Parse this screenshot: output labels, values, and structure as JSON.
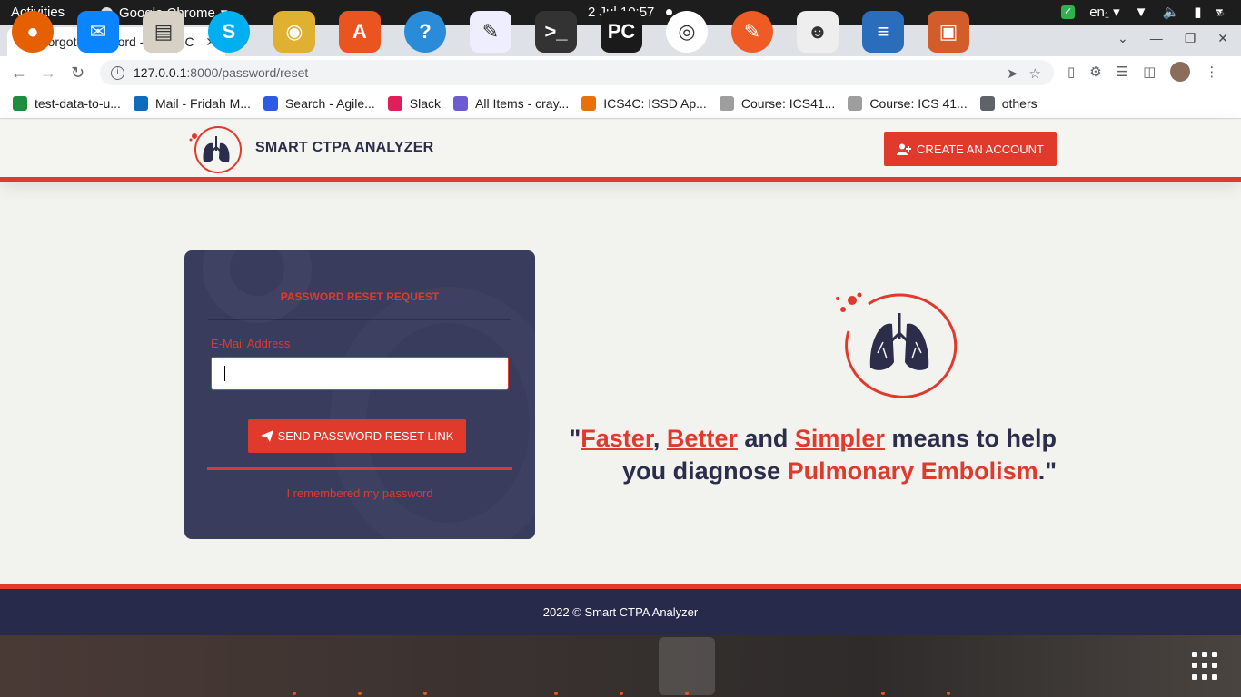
{
  "system_bar": {
    "activities": "Activities",
    "app_name": "Google Chrome",
    "clock": "2 Jul  10:57",
    "input_lang": "en₁"
  },
  "browser": {
    "tab_title": "Forgot Password - Smart C",
    "url_host": "127.0.0.1",
    "url_path": ":8000/password/reset",
    "bookmarks": [
      {
        "label": "test-data-to-u...",
        "color": "#1e8e3e"
      },
      {
        "label": "Mail - Fridah M...",
        "color": "#0f6cbd"
      },
      {
        "label": "Search - Agile...",
        "color": "#2d5be3"
      },
      {
        "label": "Slack",
        "color": "#e01e5a"
      },
      {
        "label": "All Items - cray...",
        "color": "#6d5bd0"
      },
      {
        "label": "ICS4C: ISSD Ap...",
        "color": "#e8710a"
      },
      {
        "label": "Course: ICS41...",
        "color": "#9e9e9e"
      },
      {
        "label": "Course: ICS 41...",
        "color": "#9e9e9e"
      },
      {
        "label": "others",
        "color": "#5f6368"
      }
    ]
  },
  "site": {
    "brand": "SMART CTPA ANALYZER",
    "create_account": "CREATE AN ACCOUNT",
    "accent_color": "#e03a2d",
    "navy_color": "#2b2d4a"
  },
  "reset_card": {
    "title": "PASSWORD RESET REQUEST",
    "email_label": "E-Mail Address",
    "email_value": "",
    "send_button": "SEND PASSWORD RESET LINK",
    "remember_link": "I remembered my password"
  },
  "hero": {
    "q_open": "\"",
    "word1": "Faster",
    "sep1": ", ",
    "word2": "Better",
    "and": " and ",
    "word3": "Simpler",
    "middle": " means to help you diagnose ",
    "disease": "Pulmonary Embolism",
    "q_close": ".\""
  },
  "footer": {
    "text": "2022 © Smart CTPA Analyzer"
  },
  "dock": {
    "apps": [
      "firefox-icon",
      "thunderbird-icon",
      "files-icon",
      "skype-icon",
      "rhythmbox-icon",
      "app-center-icon",
      "help-icon",
      "text-editor-icon",
      "terminal-icon",
      "pycharm-icon",
      "chrome-icon",
      "postman-icon",
      "gimp-icon",
      "writer-icon",
      "impress-icon"
    ]
  }
}
